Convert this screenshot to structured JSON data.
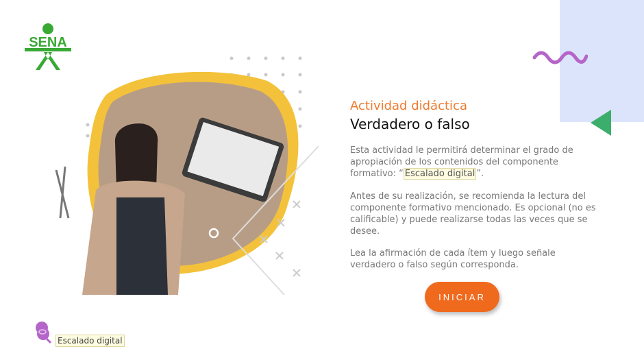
{
  "logo": {
    "text": "SENA",
    "color": "#39a935"
  },
  "activity": {
    "kicker": "Actividad didáctica",
    "title": "Verdadero o falso",
    "p1_before": "Esta actividad le permitirá determinar el grado de apropiación de los contenidos del componente formativo: “",
    "p1_highlight": "Escalado digital",
    "p1_after": "”.",
    "p2": "Antes de su realización, se recomienda la lectura del componente formativo mencionado.  Es opcional (no es calificable) y puede realizarse todas las veces que se desee.",
    "p3": "Lea la afirmación de cada ítem y luego señale verdadero o falso según corresponda.",
    "start_label": "INICIAR"
  },
  "footer": {
    "label": "Escalado digital",
    "icon": "pushpin-icon"
  },
  "colors": {
    "accent": "#f06a1e",
    "kicker": "#ee7a2e",
    "wave": "#b565c9",
    "triangle": "#3aae6a",
    "panel": "#dbe4fb",
    "blob": "#f3c23a"
  }
}
